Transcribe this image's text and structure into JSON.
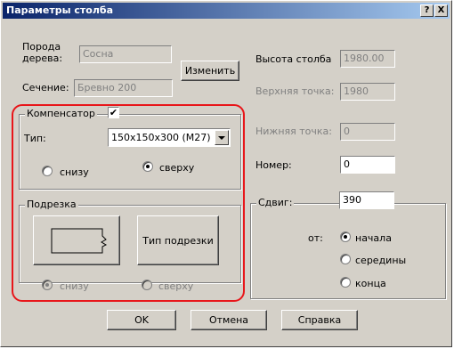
{
  "window": {
    "title": "Параметры столба",
    "help_label": "?",
    "close_label": "X"
  },
  "wood": {
    "label_line1": "Порода",
    "label_line2": "дерева:",
    "value": "Сосна"
  },
  "section": {
    "label": "Сечение:",
    "value": "Бревно 200"
  },
  "change_button": "Изменить",
  "height": {
    "label": "Высота столба",
    "value": "1980.00"
  },
  "top_point": {
    "label": "Верхняя точка:",
    "value": "1980"
  },
  "bottom_point": {
    "label": "Нижняя точка:",
    "value": "0"
  },
  "number": {
    "label": "Номер:",
    "value": "0"
  },
  "compensator": {
    "title": "Компенсатор",
    "checked_mark": "✔",
    "type_label": "Тип:",
    "type_value": "150x150x300 (M27)",
    "radio_bottom": "снизу",
    "radio_top": "сверху",
    "selected": "top"
  },
  "cutting": {
    "title": "Подрезка",
    "type_button": "Тип подрезки",
    "radio_bottom": "снизу",
    "radio_top": "сверху",
    "selected": "bottom"
  },
  "shift": {
    "title": "Сдвиг:",
    "value": "390",
    "from_label": "от:",
    "options": [
      "начала",
      "середины",
      "конца"
    ],
    "selected": "начала"
  },
  "buttons": {
    "ok": "OK",
    "cancel": "Отмена",
    "help": "Справка"
  },
  "colors": {
    "highlight": "#e8161a",
    "title_bar_start": "#0a246a",
    "title_bar_end": "#a6caf0"
  }
}
